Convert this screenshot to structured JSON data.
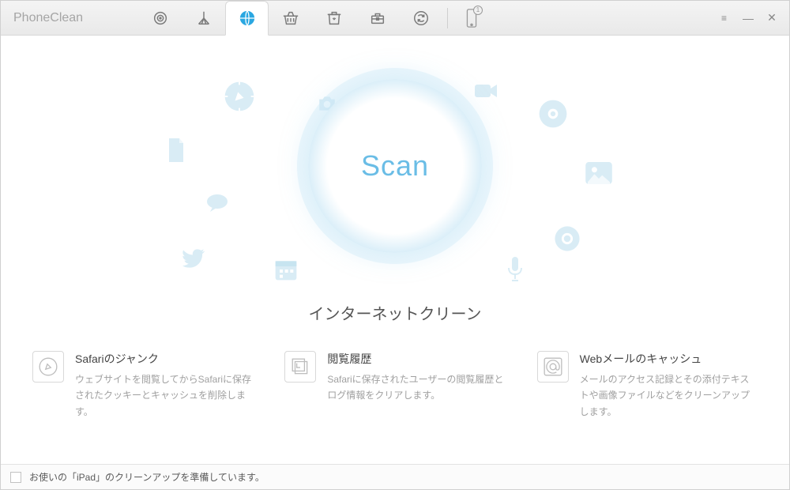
{
  "app": {
    "title": "PhoneClean"
  },
  "toolbar": {
    "active_index": 2,
    "phone_badge": "1"
  },
  "scan": {
    "label": "Scan"
  },
  "section": {
    "title": "インターネットクリーン"
  },
  "features": [
    {
      "title": "Safariのジャンク",
      "desc": "ウェブサイトを閲覧してからSafariに保存されたクッキーとキャッシュを削除します。"
    },
    {
      "title": "閲覧履歴",
      "desc": "Safariに保存されたユーザーの閲覧履歴とログ情報をクリアします。"
    },
    {
      "title": "Webメールのキャッシュ",
      "desc": "メールのアクセス記録とその添付テキストや画像ファイルなどをクリーンアップします。"
    }
  ],
  "status": {
    "text": "お使いの「iPad」のクリーンアップを準備しています。"
  }
}
